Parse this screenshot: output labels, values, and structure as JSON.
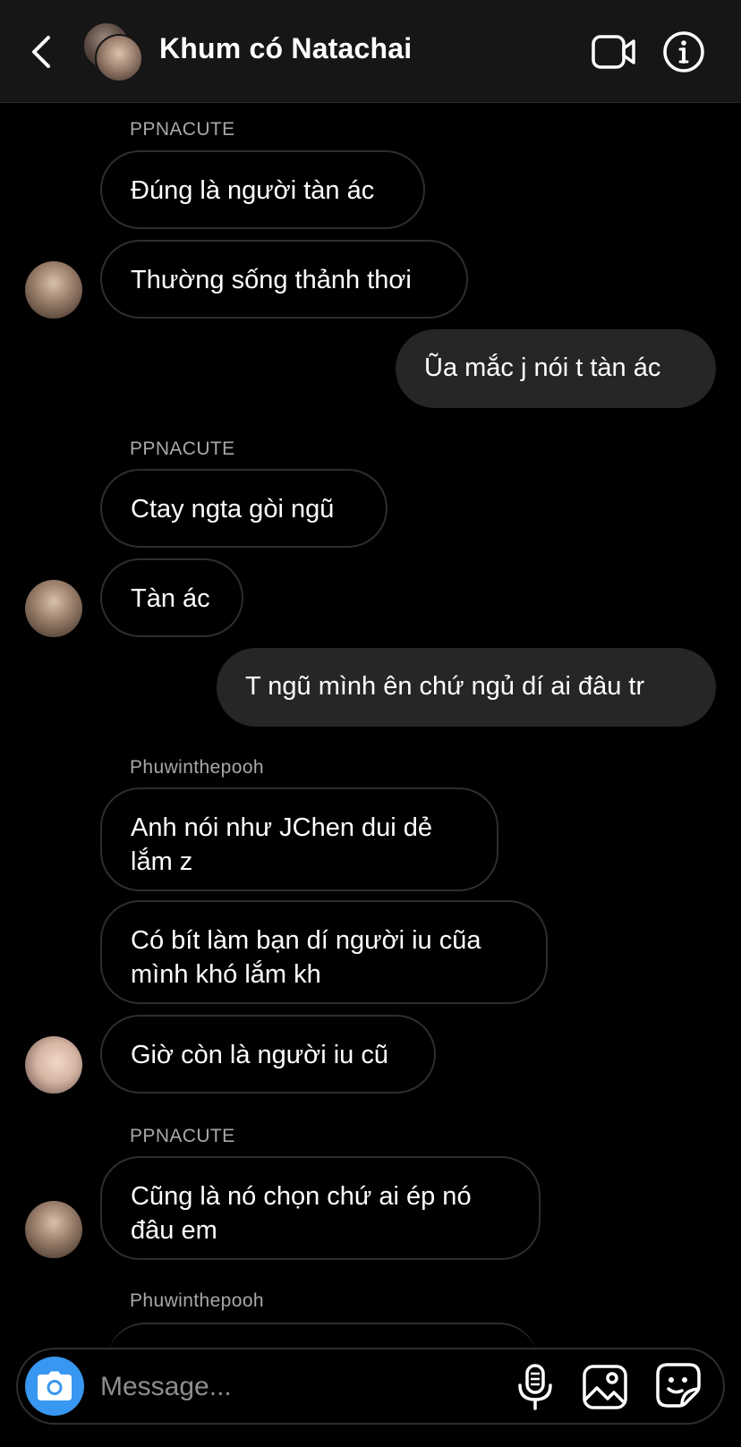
{
  "header": {
    "title": "Khum có Natachai",
    "back_icon": "chevron-left-icon",
    "video_icon": "video-camera-icon",
    "info_icon": "info-icon"
  },
  "messages": [
    {
      "sender": "PPNACUTE",
      "text": "Đúng là người tàn ác"
    },
    {
      "text": "Thường sống thảnh thơi"
    },
    {
      "text": "Ũa mắc j nói t tàn ác"
    },
    {
      "sender": "PPNACUTE",
      "text": "Ctay ngta gòi ngũ"
    },
    {
      "text": "Tàn ác"
    },
    {
      "text": "T ngũ mình ên chứ ngủ dí ai đâu tr"
    },
    {
      "sender": "Phuwinthepooh",
      "text": "Anh nói như JChen dui dẻ lắm z"
    },
    {
      "text": "Có bít làm bạn dí người iu cũa mình khó lắm kh"
    },
    {
      "text": "Giờ còn là người iu cũ"
    },
    {
      "sender": "PPNACUTE",
      "text": "Cũng là nó chọn chứ ai ép nó đâu em"
    },
    {
      "sender": "Phuwinthepooh"
    }
  ],
  "composer": {
    "placeholder": "Message...",
    "camera_icon": "camera-icon",
    "mic_icon": "microphone-icon",
    "gallery_icon": "gallery-icon",
    "sticker_icon": "sticker-icon"
  },
  "colors": {
    "background": "#000000",
    "header_bg": "#161616",
    "outgoing_bubble": "#262626",
    "incoming_border": "#2e2e2e",
    "camera_accent": "#3897f0",
    "sender_name": "#a8a8a8"
  }
}
